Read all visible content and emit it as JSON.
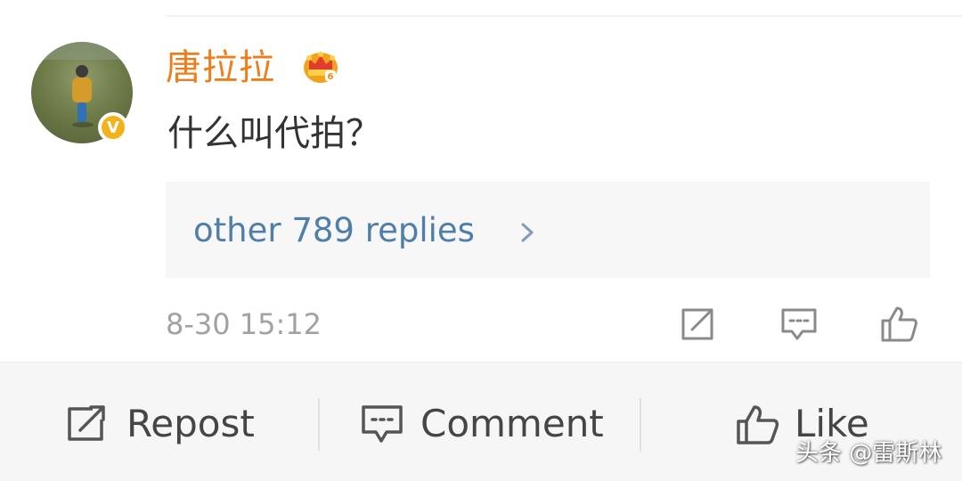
{
  "comment": {
    "username": "唐拉拉",
    "text": "什么叫代拍？",
    "verified_badge": "V",
    "badge_icon": "vip-crown-icon",
    "replies_link": "other 789 replies",
    "timestamp": "8-30 15:12",
    "actions": [
      {
        "icon": "repost-icon"
      },
      {
        "icon": "comment-icon"
      },
      {
        "icon": "like-icon"
      }
    ]
  },
  "bottom_bar": {
    "repost_label": "Repost",
    "comment_label": "Comment",
    "like_label": "Like"
  },
  "watermark": "头条 @雷斯林",
  "colors": {
    "username": "#ee7d1b",
    "link": "#4f7fa9",
    "verified": "#f3b219",
    "muted": "#a2a2a2"
  }
}
